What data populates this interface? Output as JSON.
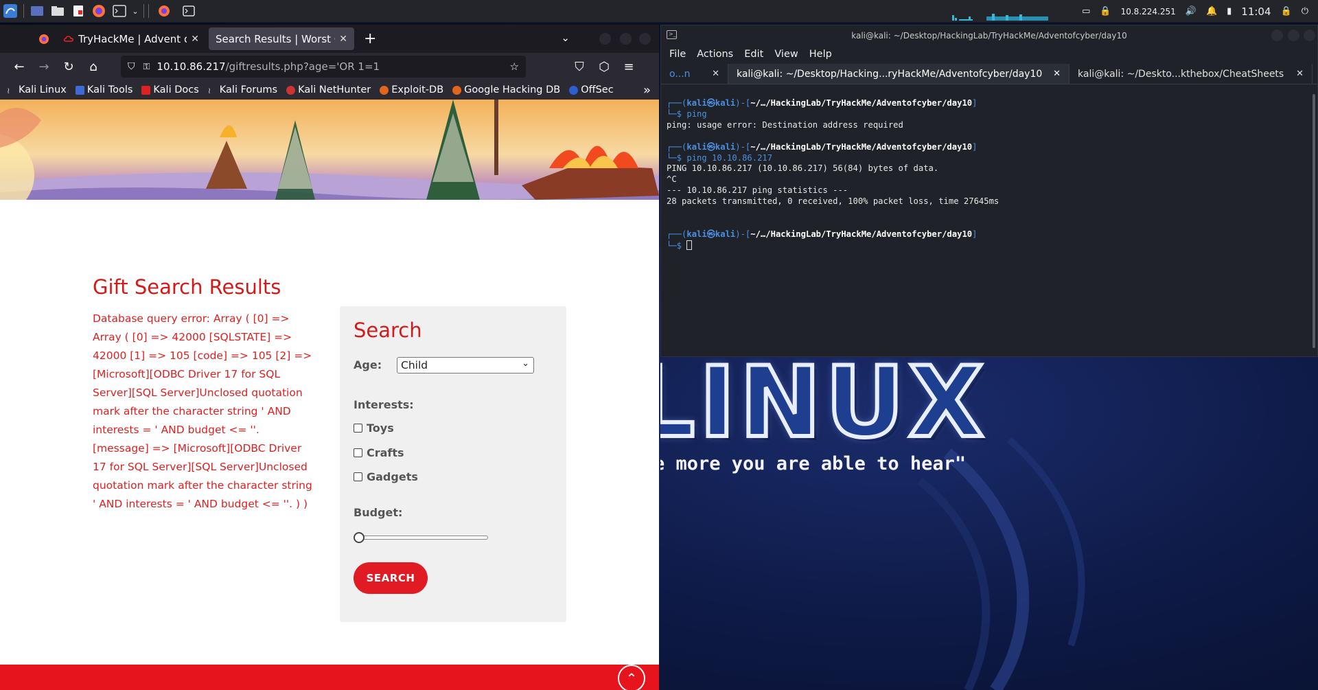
{
  "panel": {
    "ip": "10.8.224.251",
    "clock": "11:04"
  },
  "firefox": {
    "tabs": [
      {
        "title": "TryHackMe | Advent of Cy",
        "active": false
      },
      {
        "title": "Search Results | Worst Grum",
        "active": true
      }
    ],
    "url_host": "10.10.86.217",
    "url_path": "/giftresults.php?age='OR 1=1",
    "bookmarks": [
      "Kali Linux",
      "Kali Tools",
      "Kali Docs",
      "Kali Forums",
      "Kali NetHunter",
      "Exploit-DB",
      "Google Hacking DB",
      "OffSec"
    ]
  },
  "page": {
    "results_title": "Gift Search Results",
    "error_text": "Database query error: Array ( [0] => Array ( [0] => 42000 [SQLSTATE] => 42000 [1] => 105 [code] => 105 [2] => [Microsoft][ODBC Driver 17 for SQL Server][SQL Server]Unclosed quotation mark after the character string ' AND interests = ' AND budget <= ''. [message] => [Microsoft][ODBC Driver 17 for SQL Server][SQL Server]Unclosed quotation mark after the character string ' AND interests = ' AND budget <= ''. ) )",
    "search_title": "Search",
    "age_label": "Age:",
    "age_value": "Child",
    "interests_label": "Interests:",
    "interests": [
      "Toys",
      "Crafts",
      "Gadgets"
    ],
    "budget_label": "Budget:",
    "budget_value_fraction": 0,
    "search_button": "SEARCH",
    "colors": {
      "accent": "#e01b24",
      "heading": "#d51a1a"
    }
  },
  "terminal": {
    "title": "kali@kali: ~/Desktop/HackingLab/TryHackMe/Adventofcyber/day10",
    "menu": [
      "File",
      "Actions",
      "Edit",
      "View",
      "Help"
    ],
    "tabs": [
      {
        "label": "o...n",
        "active": false
      },
      {
        "label": "kali@kali: ~/Desktop/Hacking...ryHackMe/Adventofcyber/day10",
        "active": true
      },
      {
        "label": "kali@kali: ~/Deskto...kthebox/CheatSheets",
        "active": false
      }
    ],
    "prompt_path": "~/…/HackingLab/TryHackMe/Adventofcyber/day10",
    "cmd1": "ping",
    "out1": "ping: usage error: Destination address required",
    "cmd2": "ping 10.10.86.217",
    "out2": [
      "PING 10.10.86.217 (10.10.86.217) 56(84) bytes of data.",
      "^C",
      "--- 10.10.86.217 ping statistics ---",
      "28 packets transmitted, 0 received, 100% packet loss, time 27645ms"
    ]
  },
  "desktop": {
    "word": "LINUX",
    "quote": "e more you are able to hear\""
  }
}
